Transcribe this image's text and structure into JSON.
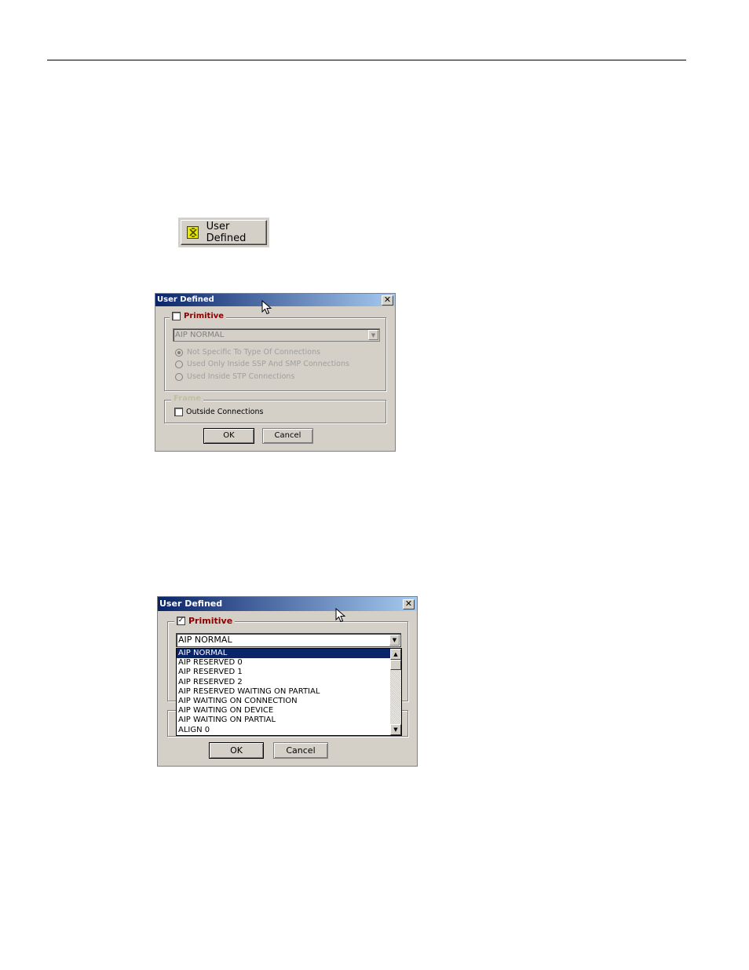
{
  "toolbar_button": {
    "label": "User Defined",
    "icon": "user-defined-icon"
  },
  "dialog1": {
    "title": "User Defined",
    "close_glyph": "✕",
    "primitive": {
      "label": "Primitive",
      "checked": false
    },
    "combo_value": "AIP NORMAL",
    "radios": [
      {
        "label": "Not Specific To Type Of Connections",
        "selected": true
      },
      {
        "label": "Used Only Inside SSP And SMP Connections",
        "selected": false
      },
      {
        "label": "Used Inside STP Connections",
        "selected": false
      }
    ],
    "frame": {
      "label": "Frame",
      "outside_label": "Outside Connections",
      "outside_checked": false
    },
    "ok_label": "OK",
    "cancel_label": "Cancel"
  },
  "dialog2": {
    "title": "User Defined",
    "close_glyph": "✕",
    "primitive": {
      "label": "Primitive",
      "checked": true,
      "check_glyph": "✓"
    },
    "combo_value": "AIP NORMAL",
    "list_items": [
      "AIP NORMAL",
      "AIP RESERVED 0",
      "AIP RESERVED 1",
      "AIP RESERVED 2",
      "AIP RESERVED WAITING ON PARTIAL",
      "AIP WAITING ON CONNECTION",
      "AIP WAITING ON DEVICE",
      "AIP WAITING ON PARTIAL",
      "ALIGN 0"
    ],
    "selected_item": "AIP NORMAL",
    "ok_label": "OK",
    "cancel_label": "Cancel"
  }
}
